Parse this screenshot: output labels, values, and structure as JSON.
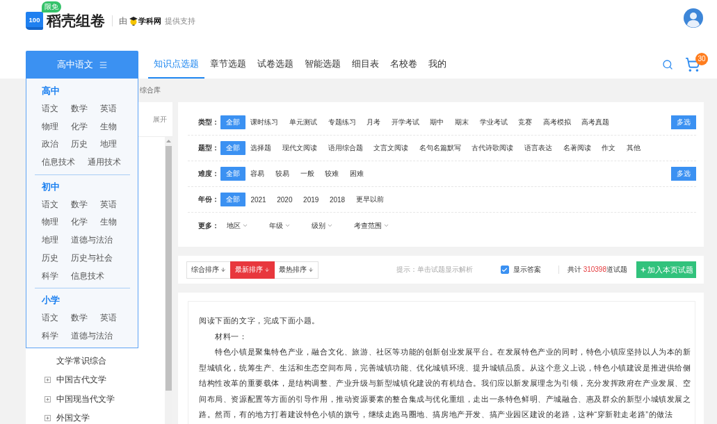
{
  "header": {
    "logo_mark": "100",
    "badge": "限免",
    "brand": "稻壳组卷",
    "by": "由",
    "partner": "学科网",
    "support": "提供支持"
  },
  "nav": {
    "subject_button": "高中语文",
    "items": [
      {
        "label": "知识点选题",
        "selected": true
      },
      {
        "label": "章节选题",
        "selected": false
      },
      {
        "label": "试卷选题",
        "selected": false
      },
      {
        "label": "智能选题",
        "selected": false
      },
      {
        "label": "细目表",
        "selected": false
      },
      {
        "label": "名校卷",
        "selected": false
      },
      {
        "label": "我的",
        "selected": false
      }
    ],
    "cart_count": "30"
  },
  "subject_menu": {
    "sections": [
      {
        "title": "高中",
        "items": [
          "语文",
          "数学",
          "英语",
          "物理",
          "化学",
          "生物",
          "政治",
          "历史",
          "地理",
          "信息技术",
          "通用技术"
        ]
      },
      {
        "title": "初中",
        "items": [
          "语文",
          "数学",
          "英语",
          "物理",
          "化学",
          "生物",
          "地理",
          "道德与法治",
          "历史",
          "历史与社会",
          "科学",
          "信息技术"
        ]
      },
      {
        "title": "小学",
        "items": [
          "语文",
          "数学",
          "英语",
          "科学",
          "道德与法治"
        ]
      }
    ]
  },
  "breadcrumb": "综合库",
  "sidebar": {
    "expand": "展开",
    "tree": [
      {
        "label": "文学常识综合",
        "kind": "leaf"
      },
      {
        "label": "中国古代文学",
        "kind": "branch"
      },
      {
        "label": "中国现当代文学",
        "kind": "branch"
      },
      {
        "label": "外国文学",
        "kind": "branch"
      }
    ]
  },
  "filters": {
    "rows": [
      {
        "kind": "options",
        "label": "类型：",
        "options": [
          {
            "label": "全部",
            "selected": true
          },
          {
            "label": "课时练习",
            "selected": false
          },
          {
            "label": "单元测试",
            "selected": false
          },
          {
            "label": "专题练习",
            "selected": false
          },
          {
            "label": "月考",
            "selected": false
          },
          {
            "label": "开学考试",
            "selected": false
          },
          {
            "label": "期中",
            "selected": false
          },
          {
            "label": "期末",
            "selected": false
          },
          {
            "label": "学业考试",
            "selected": false
          },
          {
            "label": "竞赛",
            "selected": false
          },
          {
            "label": "高考模拟",
            "selected": false
          },
          {
            "label": "高考真题",
            "selected": false
          }
        ],
        "multi_select": "多选"
      },
      {
        "kind": "options",
        "label": "题型：",
        "options": [
          {
            "label": "全部",
            "selected": true
          },
          {
            "label": "选择题",
            "selected": false
          },
          {
            "label": "现代文阅读",
            "selected": false
          },
          {
            "label": "语用综合题",
            "selected": false
          },
          {
            "label": "文言文阅读",
            "selected": false
          },
          {
            "label": "名句名篇默写",
            "selected": false
          },
          {
            "label": "古代诗歌阅读",
            "selected": false
          },
          {
            "label": "语言表达",
            "selected": false
          },
          {
            "label": "名著阅读",
            "selected": false
          },
          {
            "label": "作文",
            "selected": false
          },
          {
            "label": "其他",
            "selected": false
          }
        ]
      },
      {
        "kind": "options",
        "label": "难度：",
        "options": [
          {
            "label": "全部",
            "selected": true
          },
          {
            "label": "容易",
            "selected": false
          },
          {
            "label": "较易",
            "selected": false
          },
          {
            "label": "一般",
            "selected": false
          },
          {
            "label": "较难",
            "selected": false
          },
          {
            "label": "困难",
            "selected": false
          }
        ],
        "multi_select": "多选"
      },
      {
        "kind": "options",
        "label": "年份：",
        "options": [
          {
            "label": "全部",
            "selected": true
          },
          {
            "label": "2021",
            "selected": false
          },
          {
            "label": "2020",
            "selected": false
          },
          {
            "label": "2019",
            "selected": false
          },
          {
            "label": "2018",
            "selected": false
          },
          {
            "label": "更早以前",
            "selected": false
          }
        ]
      },
      {
        "kind": "dropdowns",
        "label": "更多：",
        "options": [
          "地区",
          "年级",
          "级别",
          "考查范围"
        ]
      }
    ]
  },
  "sort_bar": {
    "sorts": [
      {
        "label": "综合排序",
        "selected": false
      },
      {
        "label": "最新排序",
        "selected": true
      },
      {
        "label": "最热排序",
        "selected": false
      }
    ],
    "hint": "提示：单击试题显示解析",
    "show_answer": {
      "label": "显示答案",
      "checked": true
    },
    "total_prefix": "共计",
    "total_count": "310398",
    "total_suffix": "道试题",
    "add_button": "加入本页试题"
  },
  "question": {
    "intro": "阅读下面的文字，完成下面小题。",
    "material_title": "材料一：",
    "paragraph": "特色小镇是聚集特色产业，融合文化、旅游、社区等功能的创新创业发展平台。在发展特色产业的同时，特色小镇应坚持以人为本的新型城镇化，统筹生产、生活和生态空间布局，完善城镇功能、优化城镇环境、提升城镇品质。从这个意义上说，特色小镇建设是推进供给侧结构性改革的重要载体，是结构调整、产业升级与新型城镇化建设的有机结合。我们应以新发展理念为引领，充分发挥政府在产业发展、空间布局、资源配置等方面的引导作用，推动资源要素的整合集成与优化重组，走出一条特色鲜明、产城融合、惠及群众的新型小城镇发展之路。然而，有的地方打着建设特色小镇的旗号，继续走跑马圈地、搞房地产开发、搞产业园区建设的老路，这种“穿新鞋走老路”的做法"
  }
}
